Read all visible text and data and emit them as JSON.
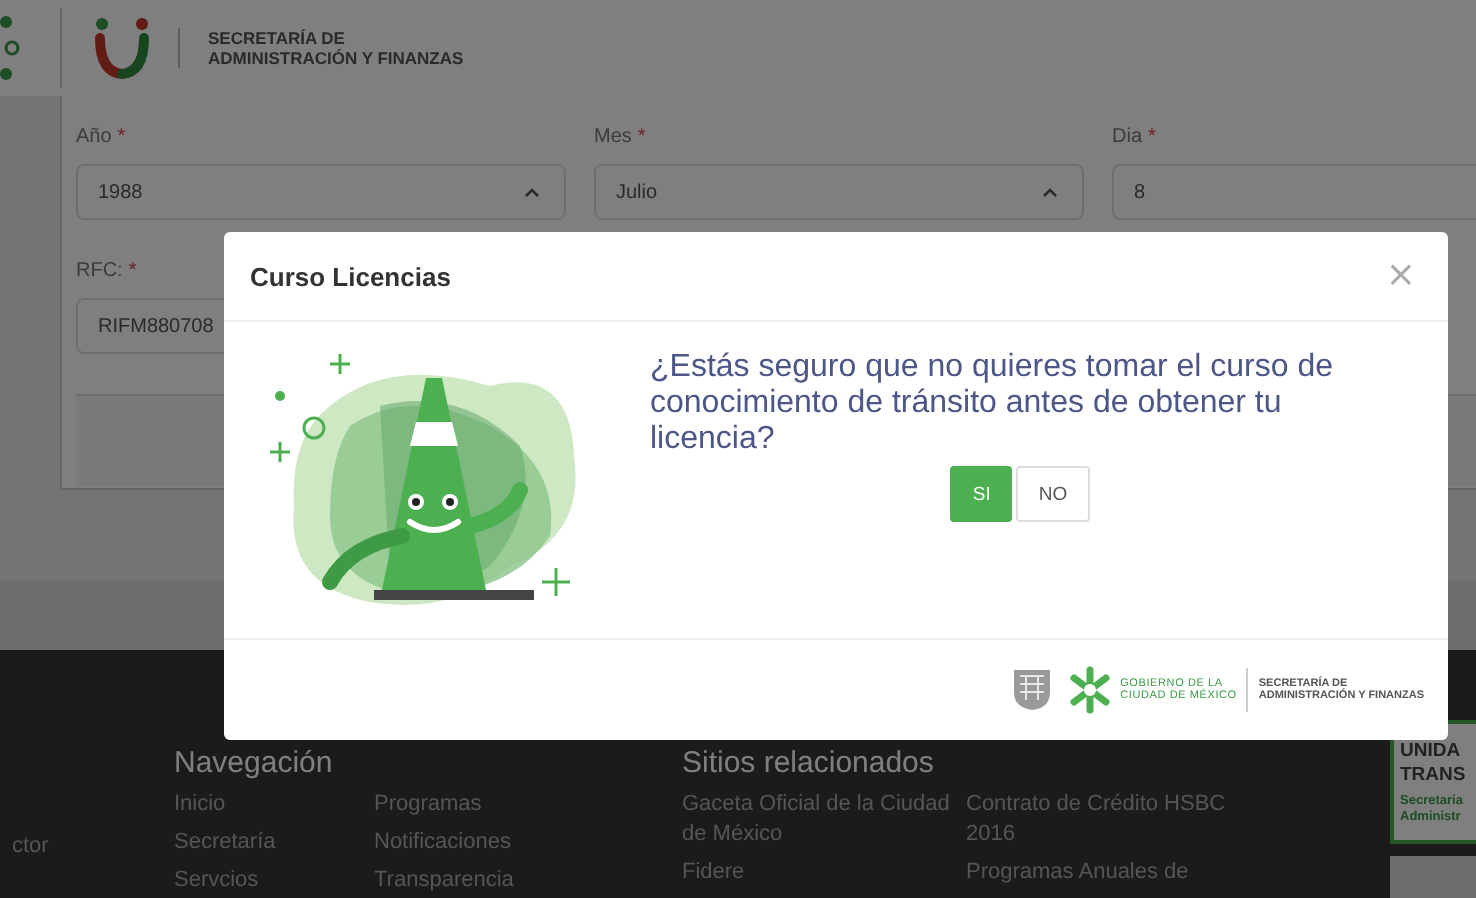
{
  "header": {
    "title_lines": [
      "SECRETARÍA DE",
      "ADMINISTRACIÓN Y FINANZAS"
    ]
  },
  "form": {
    "fields": [
      {
        "label": "Año",
        "mark": "*",
        "value": "1988",
        "kind": "select"
      },
      {
        "label": "Mes",
        "mark": "*",
        "value": "Julio",
        "kind": "select"
      },
      {
        "label": "Dia",
        "mark": "*",
        "value": "8",
        "kind": "input"
      },
      {
        "label": "RFC:",
        "mark": "*",
        "value": "RIFM880708",
        "kind": "input"
      }
    ]
  },
  "footer": {
    "left_fragment": "ctor",
    "sections": [
      {
        "heading": "Navegación",
        "columns": [
          [
            "Inicio",
            "Secretaría",
            "Servcios"
          ],
          [
            "Programas",
            "Notificaciones",
            "Transparencia"
          ]
        ]
      },
      {
        "heading": "Sitios relacionados",
        "columns": [
          [
            "Gaceta Oficial de la Ciudad de México",
            "Fidere"
          ],
          [
            "Contrato de Crédito HSBC 2016",
            "Programas Anuales de"
          ]
        ]
      }
    ],
    "side_card": {
      "title_lines": [
        "UNIDA",
        "TRANS"
      ],
      "sub_lines": [
        "Secretaria",
        "Administr"
      ]
    }
  },
  "modal": {
    "title": "Curso Licencias",
    "close": "×",
    "question": "¿Estás seguro que no quieres tomar el curso de conocimiento de tránsito antes de obtener tu licencia?",
    "buttons": [
      {
        "label": "SI",
        "kind": "primary"
      },
      {
        "label": "NO",
        "kind": "secondary"
      }
    ],
    "logos": {
      "government_lines": [
        "GOBIERNO DE LA",
        "CIUDAD DE MÉXICO"
      ],
      "department_lines": [
        "SECRETARÍA DE",
        "ADMINISTRACIÓN Y FINANZAS"
      ]
    }
  }
}
